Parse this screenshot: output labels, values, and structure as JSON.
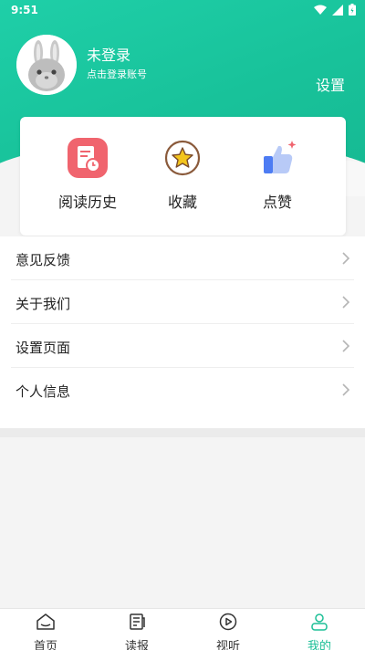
{
  "status_bar": {
    "time": "9:51"
  },
  "profile": {
    "username": "未登录",
    "login_hint": "点击登录账号",
    "settings_label": "设置"
  },
  "quick_actions": [
    {
      "label": "阅读历史",
      "icon": "reading-history-icon"
    },
    {
      "label": "收藏",
      "icon": "star-icon"
    },
    {
      "label": "点赞",
      "icon": "thumbs-up-icon"
    }
  ],
  "menu": [
    {
      "label": "意见反馈"
    },
    {
      "label": "关于我们"
    },
    {
      "label": "设置页面"
    },
    {
      "label": "个人信息"
    }
  ],
  "tabs": [
    {
      "label": "首页",
      "icon": "home-icon"
    },
    {
      "label": "读报",
      "icon": "newspaper-icon"
    },
    {
      "label": "视听",
      "icon": "play-icon"
    },
    {
      "label": "我的",
      "icon": "profile-icon",
      "active": true
    }
  ],
  "colors": {
    "accent": "#1bbf96",
    "history_icon_bg": "#f0646e",
    "star_color": "#f3c51d",
    "like_color": "#4d7cf3"
  }
}
